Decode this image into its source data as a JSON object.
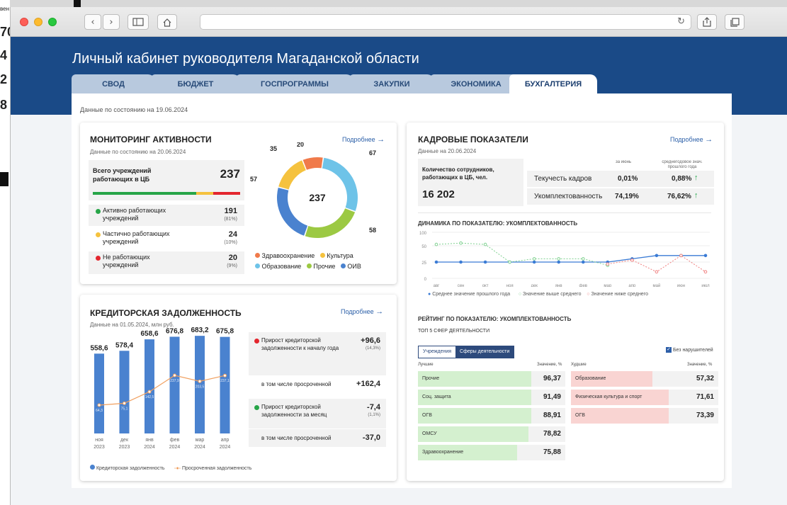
{
  "browser": {
    "address": "",
    "back_icon": "chevron-left",
    "forward_icon": "chevron-right"
  },
  "background": {
    "fragments": [
      "вен",
      "70",
      "4",
      "2",
      "8"
    ]
  },
  "header": {
    "title": "Личный кабинет руководителя Магаданской области"
  },
  "tabs": [
    {
      "label": "СВОД",
      "active": false
    },
    {
      "label": "БЮДЖЕТ",
      "active": false
    },
    {
      "label": "ГОСПРОГРАММЫ",
      "active": false
    },
    {
      "label": "ЗАКУПКИ",
      "active": false
    },
    {
      "label": "ЭКОНОМИКА",
      "active": false
    },
    {
      "label": "БУХГАЛТЕРИЯ",
      "active": true
    }
  ],
  "main": {
    "date": "Данные по состоянию на 19.06.2024"
  },
  "monitoring": {
    "title": "МОНИТОРИНГ АКТИВНОСТИ",
    "date": "Данные по состоянию на 20.06.2024",
    "more": "Подробнее",
    "total_label": "Всего учреждений работающих в ЦБ",
    "total_value": "237",
    "rows": [
      {
        "label": "Активно работающих учреждений",
        "value": "191",
        "pct": "(81%)",
        "color": "#27a548"
      },
      {
        "label": "Частично работающих учреждений",
        "value": "24",
        "pct": "(10%)",
        "color": "#f5c23e"
      },
      {
        "label": "Не работающих учреждений",
        "value": "20",
        "pct": "(9%)",
        "color": "#e3262e"
      }
    ],
    "donut": {
      "center": "237",
      "segments": [
        {
          "name": "Образование",
          "value": 67,
          "label": "67",
          "color": "#6ec3e8"
        },
        {
          "name": "Прочие",
          "value": 58,
          "label": "58",
          "color": "#9cc943"
        },
        {
          "name": "ОИВ",
          "value": 57,
          "label": "57",
          "color": "#4a82cf"
        },
        {
          "name": "Культура",
          "value": 35,
          "label": "35",
          "color": "#f5c23e"
        },
        {
          "name": "Здравоохранение",
          "value": 20,
          "label": "20",
          "color": "#f07a4a"
        }
      ],
      "legend": [
        {
          "name": "Здравоохранение",
          "color": "#f07a4a"
        },
        {
          "name": "Культура",
          "color": "#f5c23e"
        },
        {
          "name": "Образование",
          "color": "#6ec3e8"
        },
        {
          "name": "Прочие",
          "color": "#9cc943"
        },
        {
          "name": "ОИВ",
          "color": "#4a82cf"
        }
      ]
    }
  },
  "hr": {
    "title": "КАДРОВЫЕ ПОКАЗАТЕЛИ",
    "date": "Данные на 20.06.2024",
    "more": "Подробнее",
    "staff_label": "Количество сотрудников, работающих в ЦБ, чел.",
    "staff_value": "16 202",
    "col1": "за июнь",
    "col2": "среднегодовое знач. прошлого года",
    "rows": [
      {
        "label": "Текучесть кадров",
        "v1": "0,01%",
        "v2": "0,88%"
      },
      {
        "label": "Укомплектованность",
        "v1": "74,19%",
        "v2": "76,62%"
      }
    ]
  },
  "dynamics": {
    "title": "ДИНАМИКА ПО ПОКАЗАТЕЛЮ: УКОМПЛЕКТОВАННОСТЬ",
    "legend": [
      "Среднее значение прошлого года",
      "Значение выше среднего",
      "Значение ниже среднего"
    ]
  },
  "rating": {
    "title": "РЕЙТИНГ ПО ПОКАЗАТЕЛЮ: УКОМПЛЕКТОВАННОСТЬ",
    "subtitle": "ТОП 5 СФЕР ДЕЯТЕЛЬНОСТИ",
    "toggle": [
      "Учреждения",
      "Сферы деятельности"
    ],
    "checkbox": "Без нарушителей",
    "best_header": "Лучшие",
    "worst_header": "Худшие",
    "value_header": "Значение, %",
    "best": [
      {
        "name": "Прочие",
        "value": "96,37"
      },
      {
        "name": "Соц. защита",
        "value": "91,49"
      },
      {
        "name": "ОГВ",
        "value": "88,91"
      },
      {
        "name": "ОМСУ",
        "value": "78,82"
      },
      {
        "name": "Здравоохранение",
        "value": "75,88"
      }
    ],
    "worst": [
      {
        "name": "Образование",
        "value": "57,32"
      },
      {
        "name": "Физическая культура и спорт",
        "value": "71,61"
      },
      {
        "name": "ОГВ",
        "value": "73,39"
      }
    ]
  },
  "credit": {
    "title": "КРЕДИТОРСКАЯ ЗАДОЛЖЕННОСТЬ",
    "date": "Данные на 01.05.2024, млн руб.",
    "more": "Подробнее",
    "legend": [
      "Кредиторская задолженность",
      "Просроченная задолженность"
    ],
    "blocks": [
      {
        "label": "Прирост кредиторской задолженности к началу года",
        "value": "+96,6",
        "pct": "(14,3%)",
        "color": "#e3262e",
        "sub_label": "в том числе просроченной",
        "sub_value": "+162,4"
      },
      {
        "label": "Прирост кредиторской задолженности за месяц",
        "value": "-7,4",
        "pct": "(1,1%)",
        "color": "#27a548",
        "sub_label": "в том числе просроченной",
        "sub_value": "-37,0"
      }
    ]
  },
  "chart_data": [
    {
      "type": "pie",
      "categories": [
        "Образование",
        "Прочие",
        "ОИВ",
        "Культура",
        "Здравоохранение"
      ],
      "values": [
        67,
        58,
        57,
        35,
        20
      ],
      "title": "",
      "center_label": "237"
    },
    {
      "type": "line",
      "categories": [
        "авг",
        "сен",
        "окт",
        "ноя",
        "дек",
        "янв",
        "фев",
        "мар",
        "апр",
        "май",
        "июн",
        "июл"
      ],
      "ylim": [
        0,
        100
      ],
      "yticks": [
        "100",
        "50",
        "25",
        "0"
      ],
      "series": [
        {
          "name": "Среднее значение прошлого года",
          "values": [
            25,
            25,
            25,
            25,
            25,
            25,
            25,
            25,
            30,
            35,
            35,
            35
          ],
          "color": "#3a7bd5"
        },
        {
          "name": "Значение выше среднего",
          "values": [
            55,
            60,
            55,
            25,
            30,
            30,
            30,
            20,
            null,
            null,
            35,
            null
          ],
          "color": "#7fd190"
        },
        {
          "name": "Значение ниже среднего",
          "values": [
            null,
            null,
            null,
            null,
            null,
            null,
            null,
            22,
            28,
            10,
            35,
            10
          ],
          "color": "#f08080"
        }
      ]
    },
    {
      "type": "bar",
      "categories": [
        "ноя 2023",
        "дек 2023",
        "янв 2024",
        "фев 2024",
        "мар 2024",
        "апр 2024"
      ],
      "x_top": [
        "ноя",
        "дек",
        "янв",
        "фев",
        "мар",
        "апр"
      ],
      "x_bottom": [
        "2023",
        "2023",
        "2024",
        "2024",
        "2024",
        "2024"
      ],
      "series": [
        {
          "name": "Кредиторская задолженность",
          "values": [
            558.6,
            578.4,
            658.6,
            676.8,
            683.2,
            675.8
          ],
          "labels": [
            "558,6",
            "578,4",
            "658,6",
            "676,8",
            "683,2",
            "675,8"
          ],
          "color": "#4a82cf"
        },
        {
          "name": "Просроченная задолженность",
          "values": [
            64.3,
            75.1,
            142.5,
            237.9,
            203.5,
            237.1
          ],
          "labels": [
            "64,3",
            "75,1",
            "142,5",
            "237,9",
            "203,5",
            "237,1"
          ],
          "color": "#f0a060"
        }
      ],
      "ylim": [
        0,
        700
      ]
    }
  ]
}
